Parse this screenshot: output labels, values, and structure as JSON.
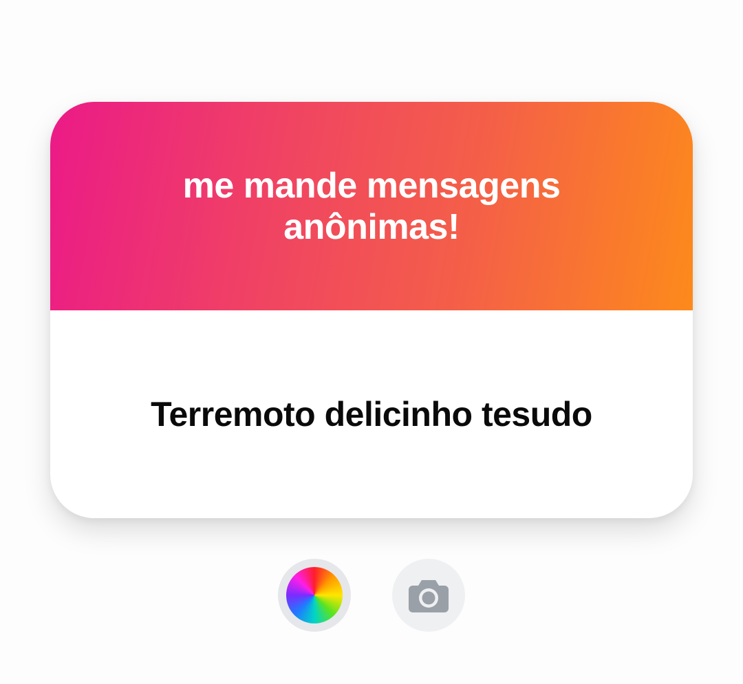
{
  "question_sticker": {
    "prompt": "me mande mensagens anônimas!",
    "answer": "Terremoto delicinho tesudo",
    "gradient_colors": [
      "#eb1a87",
      "#f04363",
      "#f45f48",
      "#fd8a1b"
    ]
  },
  "controls": {
    "color_button_icon": "color-wheel-icon",
    "camera_button_icon": "camera-icon",
    "camera_icon_color": "#9aa0a8"
  }
}
